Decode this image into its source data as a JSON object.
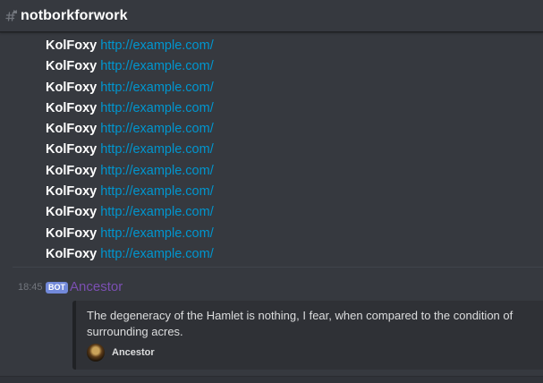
{
  "channel": {
    "name": "notborkforwork",
    "icon": "text-channel-locked-icon"
  },
  "messages": [
    {
      "author": "KolFoxy",
      "link": "http://example.com/"
    },
    {
      "author": "KolFoxy",
      "link": "http://example.com/"
    },
    {
      "author": "KolFoxy",
      "link": "http://example.com/"
    },
    {
      "author": "KolFoxy",
      "link": "http://example.com/"
    },
    {
      "author": "KolFoxy",
      "link": "http://example.com/"
    },
    {
      "author": "KolFoxy",
      "link": "http://example.com/"
    },
    {
      "author": "KolFoxy",
      "link": "http://example.com/"
    },
    {
      "author": "KolFoxy",
      "link": "http://example.com/"
    },
    {
      "author": "KolFoxy",
      "link": "http://example.com/"
    },
    {
      "author": "KolFoxy",
      "link": "http://example.com/"
    },
    {
      "author": "KolFoxy",
      "link": "http://example.com/"
    }
  ],
  "bot_message": {
    "timestamp": "18:45",
    "tag": "BOT",
    "author": "Ancestor",
    "author_color": "#7b4fb2",
    "embed": {
      "description": "The degeneracy of the Hamlet is nothing, I fear, when compared to the condition of surrounding acres.",
      "footer_text": "Ancestor",
      "footer_icon": "ancestor-avatar-icon"
    }
  },
  "colors": {
    "background": "#36393f",
    "link": "#0096cf",
    "bot_tag": "#7289da",
    "embed_bg": "#2f3136"
  }
}
